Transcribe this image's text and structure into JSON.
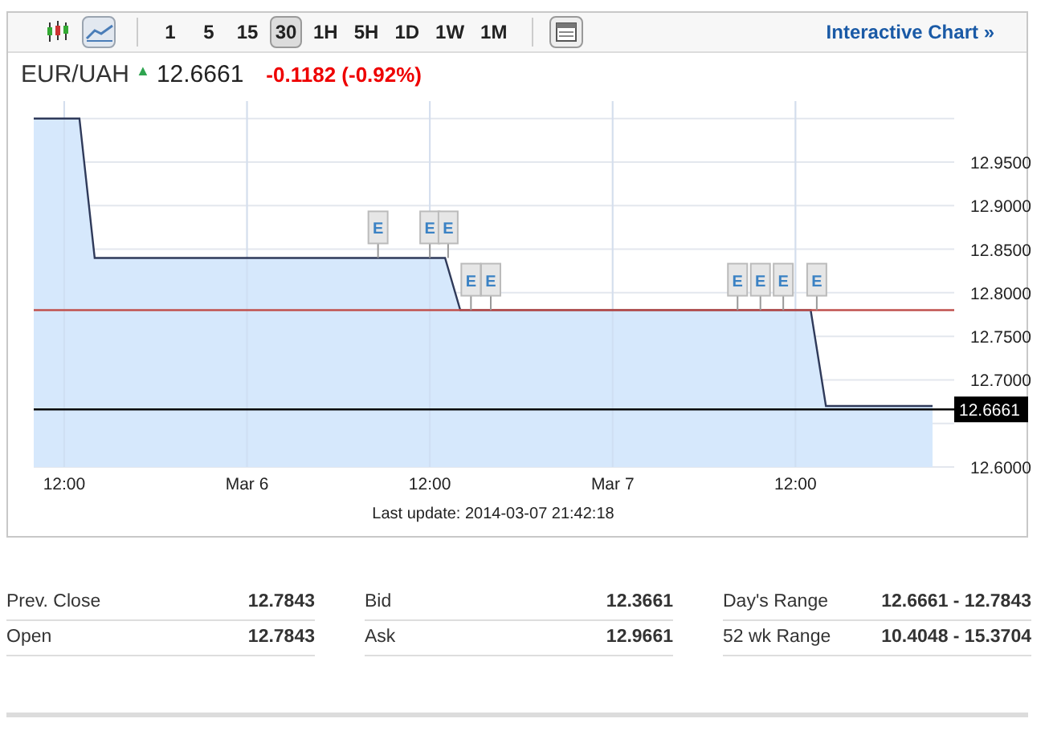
{
  "toolbar": {
    "chart_types": [
      {
        "kind": "candlestick",
        "selected": false
      },
      {
        "kind": "line",
        "selected": true
      }
    ],
    "intervals": [
      {
        "label": "1",
        "selected": false
      },
      {
        "label": "5",
        "selected": false
      },
      {
        "label": "15",
        "selected": false
      },
      {
        "label": "30",
        "selected": true
      },
      {
        "label": "1H",
        "selected": false
      },
      {
        "label": "5H",
        "selected": false
      },
      {
        "label": "1D",
        "selected": false
      },
      {
        "label": "1W",
        "selected": false
      },
      {
        "label": "1M",
        "selected": false
      }
    ],
    "link": "Interactive Chart »"
  },
  "quote": {
    "symbol": "EUR/UAH",
    "arrow": "▲",
    "price": "12.6661",
    "change": "-0.1182 (-0.92%)"
  },
  "chart": {
    "chart_data": {
      "type": "area",
      "categories": [
        null,
        null,
        "12:00",
        null,
        null,
        null,
        null,
        null,
        null,
        null,
        null,
        null,
        null,
        null,
        "Mar 6",
        null,
        null,
        null,
        null,
        null,
        null,
        null,
        null,
        null,
        null,
        null,
        "12:00",
        null,
        null,
        null,
        null,
        null,
        null,
        null,
        null,
        null,
        null,
        null,
        "Mar 7",
        null,
        null,
        null,
        null,
        null,
        null,
        null,
        null,
        null,
        null,
        null,
        "12:00",
        null,
        null,
        null,
        null,
        null,
        null,
        null,
        null,
        null
      ],
      "series": [
        {
          "color": "#2f3a5a",
          "values": [
            13.0,
            13.0,
            13.0,
            13.0,
            12.84,
            12.84,
            12.84,
            12.84,
            12.84,
            12.84,
            12.84,
            12.84,
            12.84,
            12.84,
            12.84,
            12.84,
            12.84,
            12.84,
            12.84,
            12.84,
            12.84,
            12.84,
            12.84,
            12.84,
            12.84,
            12.84,
            12.84,
            12.84,
            12.78,
            12.78,
            12.78,
            12.78,
            12.78,
            12.78,
            12.78,
            12.78,
            12.78,
            12.78,
            12.78,
            12.78,
            12.78,
            12.78,
            12.78,
            12.78,
            12.78,
            12.78,
            12.78,
            12.78,
            12.78,
            12.78,
            12.78,
            12.78,
            12.67,
            12.67,
            12.67,
            12.67,
            12.67,
            12.67,
            12.67,
            12.67
          ]
        }
      ],
      "ylim": [
        12.6,
        13.02
      ],
      "yticks": [
        {
          "value": 12.6,
          "label": "12.6000"
        },
        {
          "value": 12.7,
          "label": "12.7000"
        },
        {
          "value": 12.75,
          "label": "12.7500"
        },
        {
          "value": 12.8,
          "label": "12.8000"
        },
        {
          "value": 12.85,
          "label": "12.8500"
        },
        {
          "value": 12.9,
          "label": "12.9000"
        },
        {
          "value": 12.95,
          "label": "12.9500"
        }
      ],
      "grid": true,
      "ref_lines": [
        {
          "axis": "y",
          "value": 12.78,
          "color": "#c0504d"
        },
        {
          "axis": "y",
          "value": 12.6661,
          "color": "#000000",
          "label": "12.6661"
        }
      ]
    },
    "event_flags": [
      "E",
      "E",
      "E",
      "E",
      "E",
      "E",
      "E",
      "E",
      "E"
    ],
    "last_update": "Last update: 2014-03-07 21:42:18"
  },
  "stats": [
    [
      {
        "label": "Prev. Close",
        "value": "12.7843"
      },
      {
        "label": "Open",
        "value": "12.7843"
      }
    ],
    [
      {
        "label": "Bid",
        "value": "12.3661"
      },
      {
        "label": "Ask",
        "value": "12.9661"
      }
    ],
    [
      {
        "label": "Day's Range",
        "value": "12.6661 - 12.7843"
      },
      {
        "label": "52 wk Range",
        "value": "10.4048 - 15.3704"
      }
    ]
  ]
}
